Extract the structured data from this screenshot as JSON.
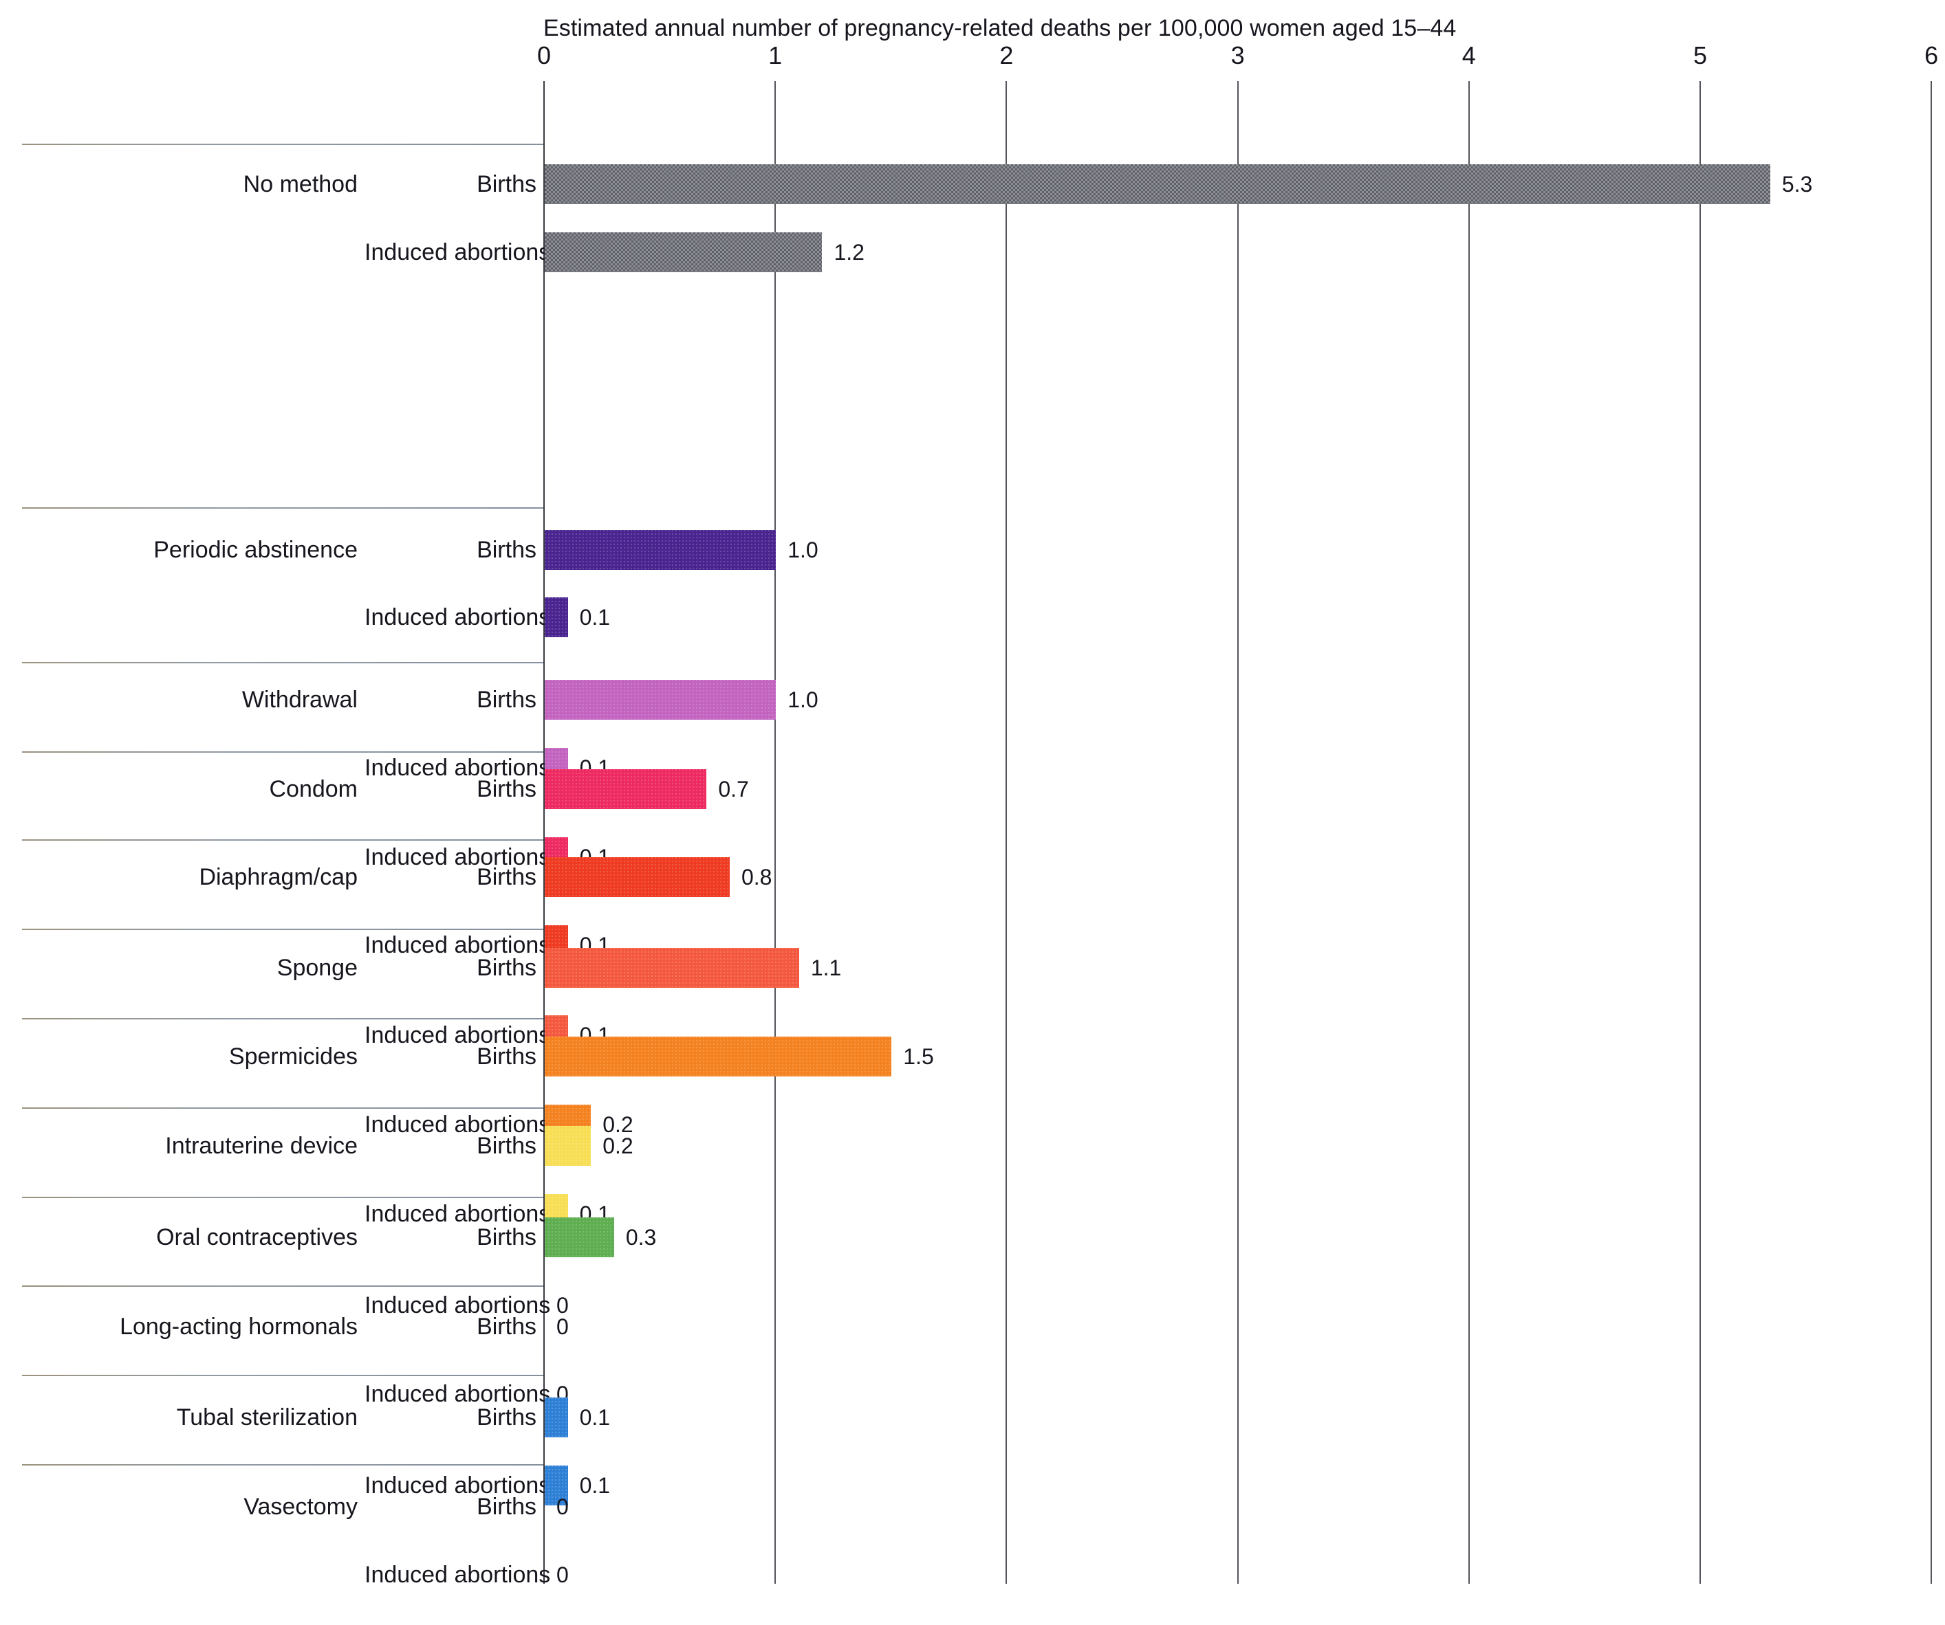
{
  "chart_data": {
    "type": "bar",
    "title": "Estimated annual number of pregnancy-related deaths per 100,000 women aged 15–44",
    "xlabel": "",
    "ylabel": "",
    "xlim": [
      0,
      6
    ],
    "xticks": [
      "0",
      "1",
      "2",
      "3",
      "4",
      "5",
      "6"
    ],
    "grid": true,
    "orientation": "horizontal",
    "legend_position": "none",
    "series_names": [
      "Births",
      "Induced abortions"
    ],
    "categories": [
      "No method",
      "Periodic abstinence",
      "Withdrawal",
      "Condom",
      "Diaphragm/cap",
      "Sponge",
      "Spermicides",
      "Intrauterine device",
      "Oral contraceptives",
      "Long-acting hormonals",
      "Tubal sterilization",
      "Vasectomy"
    ],
    "series": [
      {
        "name": "Births",
        "values": [
          5.3,
          1.0,
          1.0,
          0.7,
          0.8,
          1.1,
          1.5,
          0.2,
          0.3,
          0,
          0.1,
          0
        ]
      },
      {
        "name": "Induced abortions",
        "values": [
          1.2,
          0.1,
          0.1,
          0.1,
          0.1,
          0.1,
          0.2,
          0.1,
          0,
          0,
          0.1,
          0
        ]
      }
    ],
    "value_labels": {
      "births": [
        "5.3",
        "1.0",
        "1.0",
        "0.7",
        "0.8",
        "1.1",
        "1.5",
        "0.2",
        "0.3",
        "0",
        "0.1",
        "0"
      ],
      "induced_abortions": [
        "1.2",
        "0.1",
        "0.1",
        "0.1",
        "0.1",
        "0.1",
        "0.2",
        "0.1",
        "0",
        "0",
        "0.1",
        "0"
      ]
    },
    "colors": [
      "#5e6068",
      "#4a2590",
      "#c264c0",
      "#ee2a62",
      "#ee3b22",
      "#f4593f",
      "#f58220",
      "#f7de55",
      "#5fae51",
      "#5fae51",
      "#2e80d6",
      "#2e80d6"
    ]
  },
  "axis": {
    "title": "Estimated annual number of pregnancy-related deaths per 100,000 women aged 15–44",
    "ticks": [
      "0",
      "1",
      "2",
      "3",
      "4",
      "5",
      "6"
    ]
  },
  "labels": {
    "births": "Births",
    "induced_abortions": "Induced abortions"
  },
  "groups": [
    {
      "method": "No method",
      "color": "#5e6068",
      "pattern": "gray-dither",
      "births": {
        "series": "Births",
        "value": 5.3,
        "label": "5.3"
      },
      "abortions": {
        "series": "Induced abortions",
        "value": 1.2,
        "label": "1.2"
      }
    },
    {
      "method": "Periodic abstinence",
      "color": "#4a2590",
      "pattern": "solid",
      "births": {
        "series": "Births",
        "value": 1.0,
        "label": "1.0"
      },
      "abortions": {
        "series": "Induced abortions",
        "value": 0.1,
        "label": "0.1"
      }
    },
    {
      "method": "Withdrawal",
      "color": "#c264c0",
      "pattern": "solid",
      "births": {
        "series": "Births",
        "value": 1.0,
        "label": "1.0"
      },
      "abortions": {
        "series": "Induced abortions",
        "value": 0.1,
        "label": "0.1"
      }
    },
    {
      "method": "Condom",
      "color": "#ee2a62",
      "pattern": "solid",
      "births": {
        "series": "Births",
        "value": 0.7,
        "label": "0.7"
      },
      "abortions": {
        "series": "Induced abortions",
        "value": 0.1,
        "label": "0.1"
      }
    },
    {
      "method": "Diaphragm/cap",
      "color": "#ee3b22",
      "pattern": "solid",
      "births": {
        "series": "Births",
        "value": 0.8,
        "label": "0.8"
      },
      "abortions": {
        "series": "Induced abortions",
        "value": 0.1,
        "label": "0.1"
      }
    },
    {
      "method": "Sponge",
      "color": "#f4593f",
      "pattern": "solid",
      "births": {
        "series": "Births",
        "value": 1.1,
        "label": "1.1"
      },
      "abortions": {
        "series": "Induced abortions",
        "value": 0.1,
        "label": "0.1"
      }
    },
    {
      "method": "Spermicides",
      "color": "#f58220",
      "pattern": "solid",
      "births": {
        "series": "Births",
        "value": 1.5,
        "label": "1.5"
      },
      "abortions": {
        "series": "Induced abortions",
        "value": 0.2,
        "label": "0.2"
      }
    },
    {
      "method": "Intrauterine device",
      "color": "#f7de55",
      "pattern": "solid",
      "births": {
        "series": "Births",
        "value": 0.2,
        "label": "0.2"
      },
      "abortions": {
        "series": "Induced abortions",
        "value": 0.1,
        "label": "0.1"
      }
    },
    {
      "method": "Oral contraceptives",
      "color": "#5fae51",
      "pattern": "solid",
      "births": {
        "series": "Births",
        "value": 0.3,
        "label": "0.3"
      },
      "abortions": {
        "series": "Induced abortions",
        "value": 0,
        "label": "0"
      }
    },
    {
      "method": "Long-acting hormonals",
      "color": "#5fae51",
      "pattern": "solid",
      "births": {
        "series": "Births",
        "value": 0,
        "label": "0"
      },
      "abortions": {
        "series": "Induced abortions",
        "value": 0,
        "label": "0"
      }
    },
    {
      "method": "Tubal sterilization",
      "color": "#2e80d6",
      "pattern": "solid",
      "births": {
        "series": "Births",
        "value": 0.1,
        "label": "0.1"
      },
      "abortions": {
        "series": "Induced abortions",
        "value": 0.1,
        "label": "0.1"
      }
    },
    {
      "method": "Vasectomy",
      "color": "#2e80d6",
      "pattern": "solid",
      "births": {
        "series": "Births",
        "value": 0,
        "label": "0"
      },
      "abortions": {
        "series": "Induced abortions",
        "value": 0,
        "label": "0"
      }
    }
  ]
}
